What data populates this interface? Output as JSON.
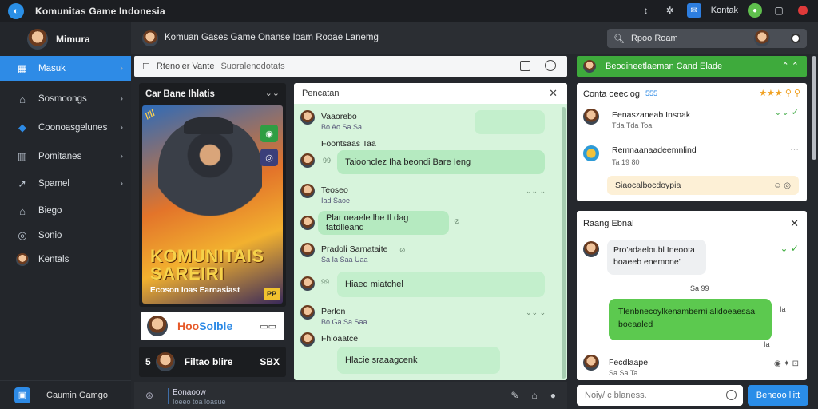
{
  "titlebar": {
    "title": "Komunitas Game Indonesia",
    "user_label": "Kontak"
  },
  "sidebar": {
    "profile_name": "Mimura",
    "items": [
      {
        "label": "Masuk",
        "icon": "home-icon"
      },
      {
        "label": "Sosmoongs",
        "icon": "store-icon"
      },
      {
        "label": "Coonoasgelunes",
        "icon": "gem-icon"
      },
      {
        "label": "Pomitanes",
        "icon": "chart-icon"
      },
      {
        "label": "Spamel",
        "icon": "pin-icon"
      },
      {
        "label": "Biego",
        "icon": "house-icon"
      },
      {
        "label": "Sonio",
        "icon": "gear-icon"
      },
      {
        "label": "Kentals",
        "icon": "user-icon"
      }
    ],
    "bottom_label": "Caumin Gamgo"
  },
  "header": {
    "title": "Komuan Gases   Game Onanse Ioam Rooae Lanemg",
    "search_value": "Rpoo Roam"
  },
  "roombar": {
    "title": "Rtenoler Vante",
    "subtitle": "Suoralenodotats"
  },
  "game_panel": {
    "title": "Car Bane Ihlatis",
    "cover_title_line1": "KOMUNITAIS",
    "cover_title_line2": "SAREIRI",
    "cover_subtitle": "Ecoson Ioas Earnasiast",
    "cover_rating": "PP"
  },
  "promo": {
    "label_a": "Hoo",
    "label_b": "Solble"
  },
  "player": {
    "rank": "5",
    "name": "Filtao blire",
    "score": "SBX"
  },
  "chat": {
    "title": "Pencatan",
    "messages": [
      {
        "name": "Vaaorebo",
        "meta": "Bo Ao  Sa Sa"
      },
      {
        "name": "Foontsaas Taa",
        "bubble": "Taioonclez Iha beondi Bare Ieng"
      },
      {
        "name": "Teoseo",
        "meta": "Iad Saoe"
      },
      {
        "name": "",
        "bubble": "Plar oeaele lhe Il dag tatdlleand"
      },
      {
        "name": "Pradoli Sarnataite",
        "meta": "Sa Ia  Saa  Uaa"
      },
      {
        "name": "",
        "bubble": "Hiaed miatchel"
      },
      {
        "name": "Perlon",
        "meta": "Bo Ga  Sa Saa"
      },
      {
        "name": "Fhloaatce",
        "bubble": "Hlacie sraaagcenk"
      }
    ]
  },
  "right": {
    "header_title": "Beodineetlaeman Cand Elade",
    "feed_title": "Conta oeeciog",
    "feed_badge": "555",
    "feed_items": [
      {
        "name": "Eenaszaneab Insoak",
        "meta": "Tda  Tda  Toa"
      },
      {
        "name": "Remnaanaadeemnlind",
        "meta": "Ta  19 80"
      }
    ],
    "feed_note": "Siaocalbocdoypia",
    "dm_title": "Raang Ebnal",
    "dm_msg1": "Pro'adaeloubl Ineoota boaeeb enemone'",
    "dm_meta1": "Sa  99",
    "dm_msg2": "Tlenbnecoylkenamberni alidoeaesaa boeaaled",
    "dm_meta2": "Ia",
    "dm_meta3": "Ia",
    "dm_footer_name": "Fecdlaape",
    "dm_footer_meta": "Sa  Sa  Ta"
  },
  "bottom": {
    "line1": "Eonaoow",
    "line2": "Ioeeo toa loasue",
    "compose_placeholder": "Noiy/ c blaness.",
    "send_label": "Beneoo llitt"
  }
}
